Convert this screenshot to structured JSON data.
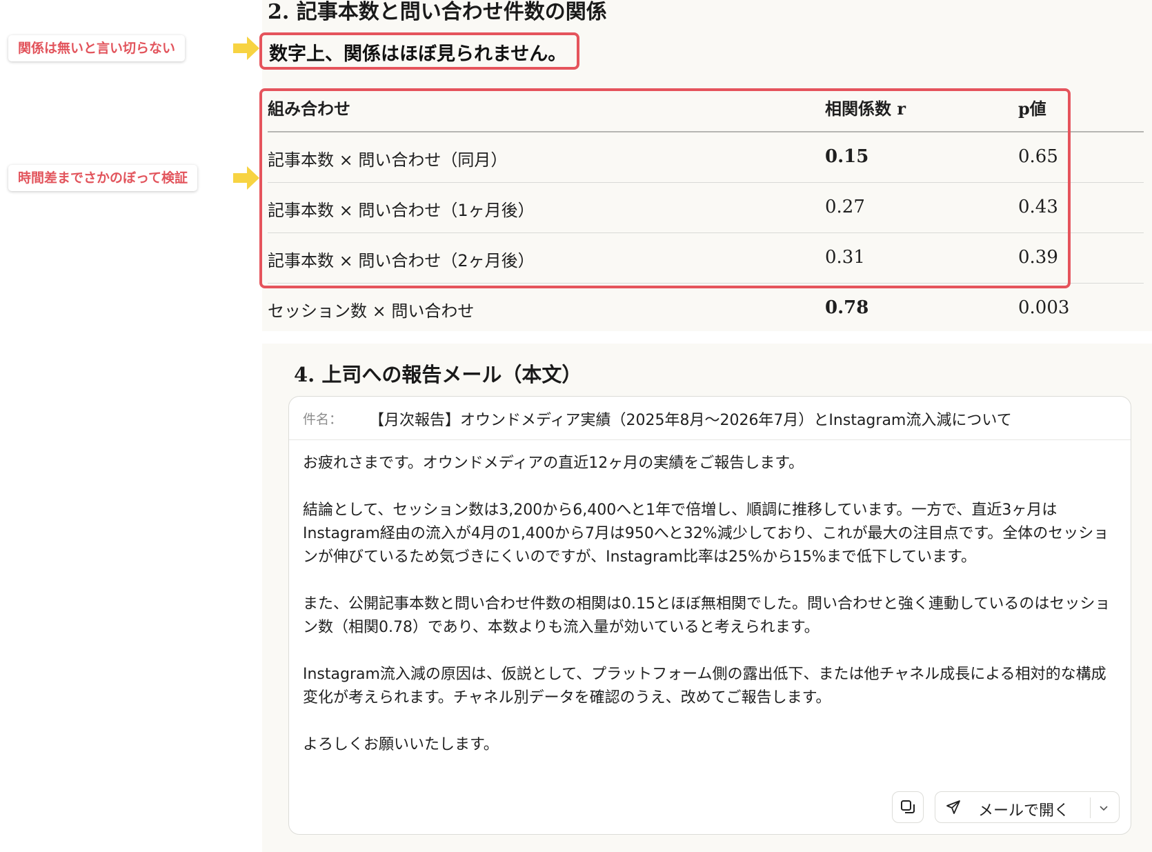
{
  "section2": {
    "title": "2. 記事本数と問い合わせ件数の関係",
    "conclusion": "数字上、関係はほぼ見られません。"
  },
  "callouts": [
    "関係は無いと言い切らない",
    "時間差までさかのぼって検証"
  ],
  "table": {
    "headers": [
      "組み合わせ",
      "相関係数 r",
      "p値"
    ],
    "rows": [
      [
        "記事本数 × 問い合わせ（同月）",
        "0.15",
        "0.65"
      ],
      [
        "記事本数 × 問い合わせ（1ヶ月後）",
        "0.27",
        "0.43"
      ],
      [
        "記事本数 × 問い合わせ（2ヶ月後）",
        "0.31",
        "0.39"
      ],
      [
        "セッション数 × 問い合わせ",
        "0.78",
        "0.003"
      ]
    ]
  },
  "section4": {
    "num": "4.",
    "title": "上司への報告メール（本文）"
  },
  "email": {
    "subject_label": "件名：",
    "subject": "【月次報告】オウンドメディア実績（2025年8月〜2026年7月）とInstagram流入減について",
    "paragraphs": [
      "お疲れさまです。オウンドメディアの直近12ヶ月の実績をご報告します。",
      "結論として、セッション数は3,200から6,400へと1年で倍増し、順調に推移しています。一方で、直近3ヶ月はInstagram経由の流入が4月の1,400から7月は950へと32%減少しており、これが最大の注目点です。全体のセッションが伸びているため気づきにくいのですが、Instagram比率は25%から15%まで低下しています。",
      "また、公開記事本数と問い合わせ件数の相関は0.15とほぼ無相関でした。問い合わせと強く連動しているのはセッション数（相関0.78）であり、本数よりも流入量が効いていると考えられます。",
      "Instagram流入減の原因は、仮説として、プラットフォーム側の露出低下、または他チャネル成長による相対的な構成変化が考えられます。チャネル別データを確認のうえ、改めてご報告します。",
      "よろしくお願いいたします。"
    ],
    "open_mail_label": "メールで開く"
  },
  "icons": {
    "arrow": "arrow-right-icon",
    "copy": "copy-icon",
    "send": "send-icon",
    "chevron": "chevron-down-icon"
  },
  "colors": {
    "highlight": "#e5545c",
    "callout_text": "#e2545c",
    "arrow": "#f7d342",
    "panel_bg": "#faf9f5"
  }
}
